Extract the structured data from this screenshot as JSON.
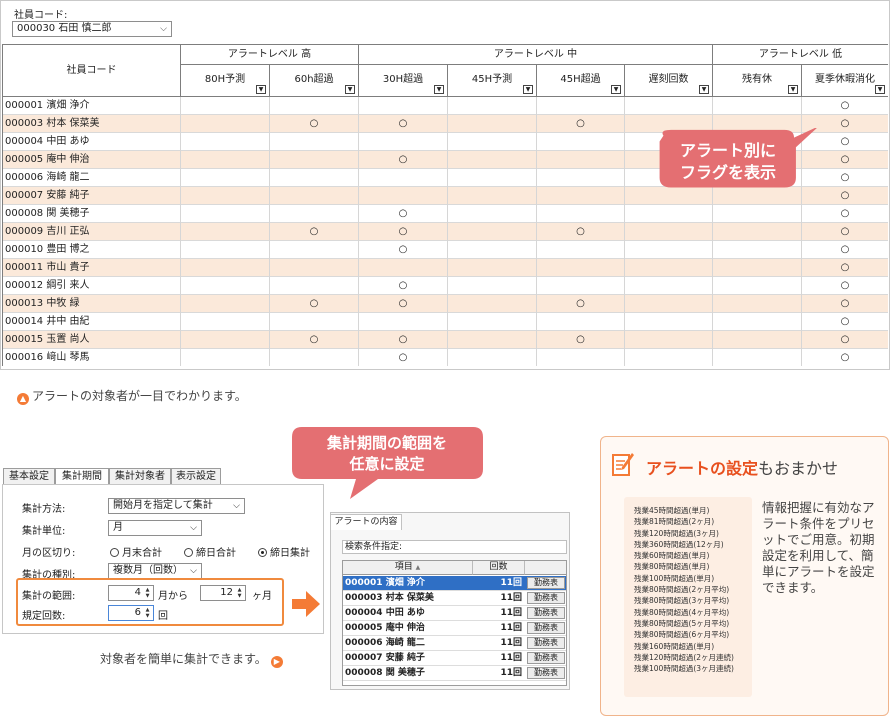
{
  "top": {
    "employee_label": "社員コード:",
    "employee_select": "000030 石田 慎二郎",
    "header": {
      "code": "社員コード",
      "group_high": "アラートレベル 高",
      "group_mid": "アラートレベル 中",
      "group_low": "アラートレベル 低",
      "cols": [
        "80H予測",
        "60h超過",
        "30H超過",
        "45H予測",
        "45H超過",
        "遅刻回数",
        "残有休",
        "夏季休暇消化"
      ]
    },
    "rows": [
      {
        "name": "000001 濱畑 浄介",
        "marks": [
          "",
          "",
          "",
          "",
          "",
          "",
          "",
          "○"
        ]
      },
      {
        "name": "000003 村本 保菜美",
        "marks": [
          "",
          "○",
          "○",
          "",
          "○",
          "",
          "",
          "○"
        ]
      },
      {
        "name": "000004 中田 あゆ",
        "marks": [
          "",
          "",
          "",
          "",
          "",
          "",
          "",
          "○"
        ]
      },
      {
        "name": "000005 庵中 伸治",
        "marks": [
          "",
          "",
          "○",
          "",
          "",
          "",
          "",
          "○"
        ]
      },
      {
        "name": "000006 海崎 龍二",
        "marks": [
          "",
          "",
          "",
          "",
          "",
          "",
          "",
          "○"
        ]
      },
      {
        "name": "000007 安藤 純子",
        "marks": [
          "",
          "",
          "",
          "",
          "",
          "",
          "",
          "○"
        ]
      },
      {
        "name": "000008 関 美穂子",
        "marks": [
          "",
          "",
          "○",
          "",
          "",
          "",
          "",
          "○"
        ]
      },
      {
        "name": "000009 吉川 正弘",
        "marks": [
          "",
          "○",
          "○",
          "",
          "○",
          "",
          "",
          "○"
        ]
      },
      {
        "name": "000010 豊田 博之",
        "marks": [
          "",
          "",
          "○",
          "",
          "",
          "",
          "",
          "○"
        ]
      },
      {
        "name": "000011 市山 貴子",
        "marks": [
          "",
          "",
          "",
          "",
          "",
          "",
          "",
          "○"
        ]
      },
      {
        "name": "000012 綱引 来人",
        "marks": [
          "",
          "",
          "○",
          "",
          "",
          "",
          "",
          "○"
        ]
      },
      {
        "name": "000013 中牧 緑",
        "marks": [
          "",
          "○",
          "○",
          "",
          "○",
          "",
          "",
          "○"
        ]
      },
      {
        "name": "000014 井中 由紀",
        "marks": [
          "",
          "",
          "",
          "",
          "",
          "",
          "",
          "○"
        ]
      },
      {
        "name": "000015 玉置 尚人",
        "marks": [
          "",
          "○",
          "○",
          "",
          "○",
          "",
          "",
          "○"
        ]
      },
      {
        "name": "000016 﨑山 琴馬",
        "marks": [
          "",
          "",
          "○",
          "",
          "",
          "",
          "",
          "○"
        ]
      }
    ]
  },
  "bubble1": {
    "line1": "アラート別に",
    "line2": "フラグを表示"
  },
  "caption_top": "アラートの対象者が一目でわかります。",
  "bubble2": {
    "line1": "集計期間の範囲を",
    "line2": "任意に設定"
  },
  "settings": {
    "tabs": [
      "基本設定",
      "集計期間",
      "集計対象者",
      "表示設定"
    ],
    "method_label": "集計方法:",
    "method_value": "開始月を指定して集計",
    "unit_label": "集計単位:",
    "unit_value": "月",
    "cutoff_label": "月の区切り:",
    "radio_options": [
      "月末合計",
      "締日合計",
      "締日集計"
    ],
    "type_label": "集計の種別:",
    "type_value": "複数月（回数）",
    "range_label": "集計の範囲:",
    "range_from": "4",
    "range_from_unit": "月から",
    "range_to": "12",
    "range_to_unit": "ヶ月",
    "count_label": "規定回数:",
    "count_value": "6",
    "count_unit": "回"
  },
  "caption_bottom": "対象者を簡単に集計できます。",
  "alert_window": {
    "tab": "アラートの内容",
    "cond_label": "検索条件指定:",
    "head_item": "項目",
    "head_count": "回数",
    "rows": [
      {
        "name": "000001 濱畑 浄介",
        "count": "11回",
        "btn": "勤務表"
      },
      {
        "name": "000003 村本 保菜美",
        "count": "11回",
        "btn": "勤務表"
      },
      {
        "name": "000004 中田 あゆ",
        "count": "11回",
        "btn": "勤務表"
      },
      {
        "name": "000005 庵中 伸治",
        "count": "11回",
        "btn": "勤務表"
      },
      {
        "name": "000006 海崎 龍二",
        "count": "11回",
        "btn": "勤務表"
      },
      {
        "name": "000007 安藤 純子",
        "count": "11回",
        "btn": "勤務表"
      },
      {
        "name": "000008 関 美穂子",
        "count": "11回",
        "btn": "勤務表"
      }
    ]
  },
  "promo": {
    "title_bold": "アラートの設定",
    "title_tail": "もおまかせ",
    "conditions": [
      "残業45時間超過(単月)",
      "残業81時間超過(2ヶ月)",
      "残業120時間超過(3ヶ月)",
      "残業360時間超過(12ヶ月)",
      "残業60時間超過(単月)",
      "残業80時間超過(単月)",
      "残業100時間超過(単月)",
      "残業80時間超過(2ヶ月平均)",
      "残業80時間超過(3ヶ月平均)",
      "残業80時間超過(4ヶ月平均)",
      "残業80時間超過(5ヶ月平均)",
      "残業80時間超過(6ヶ月平均)",
      "残業160時間超過(単月)",
      "残業120時間超過(2ヶ月連続)",
      "残業100時間超過(3ヶ月連続)"
    ],
    "text": "情報把握に有効なアラート条件をプリセットでご用意。初期設定を利用して、簡単にアラートを設定できます。"
  },
  "colors": {
    "accent": "#f47b36",
    "bubble": "#e46f72",
    "row_alt": "#fbe9da",
    "selected": "#2f6fc5"
  }
}
